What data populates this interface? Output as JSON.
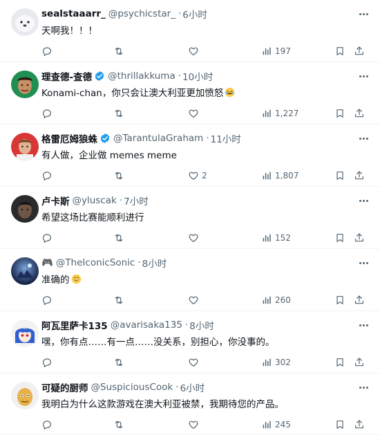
{
  "tweets": [
    {
      "name": "sealstaaarr_",
      "handle": "@psychicstar_",
      "time": "6小时",
      "verified": false,
      "text": "天啊我！！！",
      "emoji": "",
      "likes": "",
      "views": "197",
      "avatar": "seal"
    },
    {
      "name": "理查德-查德",
      "handle": "@thrillakkuma",
      "time": "10小时",
      "verified": true,
      "text": "Konami-chan，你只会让澳大利亚更加愤怒",
      "emoji": "laughing-tears-emoji",
      "likes": "",
      "views": "1,227",
      "avatar": "man-green"
    },
    {
      "name": "格雷厄姆狼蛛",
      "handle": "@TarantulaGraham",
      "time": "11小时",
      "verified": true,
      "text": "有人做，企业做 memes meme",
      "emoji": "",
      "likes": "2",
      "views": "1,807",
      "avatar": "man-red"
    },
    {
      "name": "卢卡斯",
      "handle": "@yluscak",
      "time": "7小时",
      "verified": false,
      "text": "希望这场比赛能顺利进行",
      "emoji": "",
      "likes": "",
      "views": "152",
      "avatar": "dark"
    },
    {
      "name": "🎮",
      "handle": "@TheIconicSonic",
      "time": "8小时",
      "verified": false,
      "text": "准确的",
      "emoji": "grinning-emoji",
      "likes": "",
      "views": "260",
      "avatar": "blue-game"
    },
    {
      "name": "阿瓦里萨卡135",
      "handle": "@avarisaka135",
      "time": "8小时",
      "verified": false,
      "text": "嘿，你有点……有一点……没关系，别担心，你没事的。",
      "emoji": "",
      "likes": "",
      "views": "302",
      "avatar": "anime"
    },
    {
      "name": "可疑的厨师",
      "handle": "@SuspiciousCook",
      "time": "6小时",
      "verified": false,
      "text": "我明白为什么这款游戏在澳大利亚被禁，我期待您的产品。",
      "emoji": "",
      "likes": "",
      "views": "245",
      "avatar": "cook"
    }
  ],
  "colors": {
    "text": "#0f1419",
    "muted": "#536471",
    "verified": "#1d9bf0",
    "divider": "#eff3f4"
  },
  "icons": [
    "reply-icon",
    "retweet-icon",
    "like-icon",
    "views-icon",
    "bookmark-icon",
    "share-icon",
    "more-icon",
    "verified-badge-icon"
  ]
}
